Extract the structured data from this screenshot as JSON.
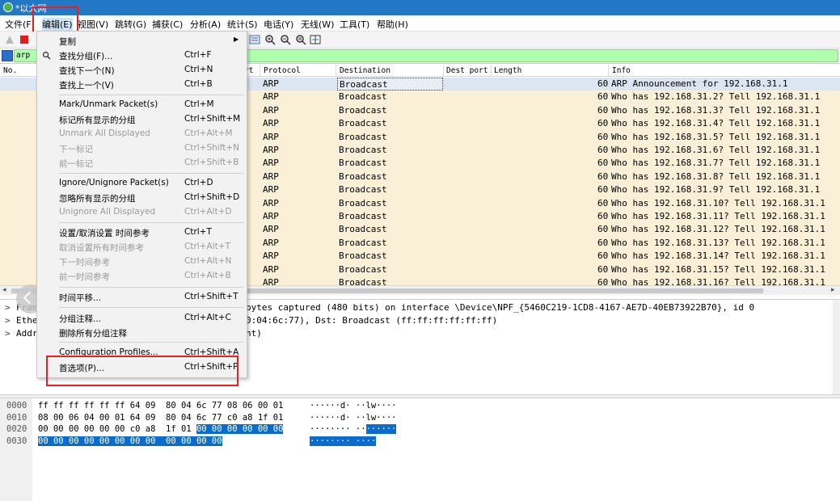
{
  "window": {
    "title": "*以太网"
  },
  "menubar": {
    "items": [
      {
        "label": "文件(F)"
      },
      {
        "label": "编辑(E)"
      },
      {
        "label": "视图(V)"
      },
      {
        "label": "跳转(G)"
      },
      {
        "label": "捕获(C)"
      },
      {
        "label": "分析(A)"
      },
      {
        "label": "统计(S)"
      },
      {
        "label": "电话(Y)"
      },
      {
        "label": "无线(W)"
      },
      {
        "label": "工具(T)"
      },
      {
        "label": "帮助(H)"
      }
    ]
  },
  "filter": {
    "value": "arp"
  },
  "packet_list": {
    "columns": [
      "No.",
      "rt",
      "Protocol",
      "Destination",
      "Dest port",
      "Length",
      "Info"
    ],
    "rows": [
      {
        "protocol": "ARP",
        "destination": "Broadcast",
        "length": "60",
        "info": "ARP Announcement for 192.168.31.1"
      },
      {
        "protocol": "ARP",
        "destination": "Broadcast",
        "length": "60",
        "info": "Who has 192.168.31.2? Tell 192.168.31.1"
      },
      {
        "protocol": "ARP",
        "destination": "Broadcast",
        "length": "60",
        "info": "Who has 192.168.31.3? Tell 192.168.31.1"
      },
      {
        "protocol": "ARP",
        "destination": "Broadcast",
        "length": "60",
        "info": "Who has 192.168.31.4? Tell 192.168.31.1"
      },
      {
        "protocol": "ARP",
        "destination": "Broadcast",
        "length": "60",
        "info": "Who has 192.168.31.5? Tell 192.168.31.1"
      },
      {
        "protocol": "ARP",
        "destination": "Broadcast",
        "length": "60",
        "info": "Who has 192.168.31.6? Tell 192.168.31.1"
      },
      {
        "protocol": "ARP",
        "destination": "Broadcast",
        "length": "60",
        "info": "Who has 192.168.31.7? Tell 192.168.31.1"
      },
      {
        "protocol": "ARP",
        "destination": "Broadcast",
        "length": "60",
        "info": "Who has 192.168.31.8? Tell 192.168.31.1"
      },
      {
        "protocol": "ARP",
        "destination": "Broadcast",
        "length": "60",
        "info": "Who has 192.168.31.9? Tell 192.168.31.1"
      },
      {
        "protocol": "ARP",
        "destination": "Broadcast",
        "length": "60",
        "info": "Who has 192.168.31.10? Tell 192.168.31.1"
      },
      {
        "protocol": "ARP",
        "destination": "Broadcast",
        "length": "60",
        "info": "Who has 192.168.31.11? Tell 192.168.31.1"
      },
      {
        "protocol": "ARP",
        "destination": "Broadcast",
        "length": "60",
        "info": "Who has 192.168.31.12? Tell 192.168.31.1"
      },
      {
        "protocol": "ARP",
        "destination": "Broadcast",
        "length": "60",
        "info": "Who has 192.168.31.13? Tell 192.168.31.1"
      },
      {
        "protocol": "ARP",
        "destination": "Broadcast",
        "length": "60",
        "info": "Who has 192.168.31.14? Tell 192.168.31.1"
      },
      {
        "protocol": "ARP",
        "destination": "Broadcast",
        "length": "60",
        "info": "Who has 192.168.31.15? Tell 192.168.31.1"
      },
      {
        "protocol": "ARP",
        "destination": "Broadcast",
        "length": "60",
        "info": "Who has 192.168.31.16? Tell 192.168.31.1"
      }
    ]
  },
  "details": {
    "rows": [
      {
        "arrow": ">",
        "text": "Fram",
        "rest": "bytes captured (480 bits) on interface \\Device\\NPF_{5460C219-1CD8-4167-AE7D-40EB73922B70}, id 0"
      },
      {
        "arrow": ">",
        "text": "Ethe",
        "rest": "0:04:6c:77), Dst: Broadcast (ff:ff:ff:ff:ff:ff)"
      },
      {
        "arrow": ">",
        "text": "Addr",
        "rest": "nt)"
      }
    ]
  },
  "bytes": {
    "rows": [
      {
        "offset": "0000",
        "hex": "ff ff ff ff ff ff 64 09  80 04 6c 77 08 06 00 01",
        "hex_sel": "",
        "ascii": "······d· ··lw····",
        "ascii_sel": ""
      },
      {
        "offset": "0010",
        "hex": "08 00 06 04 00 01 64 09  80 04 6c 77 c0 a8 1f 01",
        "hex_sel": "",
        "ascii": "······d· ··lw····",
        "ascii_sel": ""
      },
      {
        "offset": "0020",
        "hex": "00 00 00 00 00 00 c0 a8  1f 01 ",
        "hex_sel": "00 00 00 00 00 00",
        "ascii": "········ ··",
        "ascii_sel": "······"
      },
      {
        "offset": "0030",
        "hex": "",
        "hex_sel": "00 00 00 00 00 00 00 00  00 00 00 00",
        "ascii": "",
        "ascii_sel": "········ ····"
      }
    ]
  },
  "edit_menu": {
    "items": [
      {
        "label": "复制",
        "shortcut": "",
        "submenu": "▶",
        "disabled": false
      },
      {
        "label": "查找分组(F)...",
        "shortcut": "Ctrl+F",
        "icon": "search-icon",
        "disabled": false
      },
      {
        "label": "查找下一个(N)",
        "shortcut": "Ctrl+N",
        "disabled": false
      },
      {
        "label": "查找上一个(V)",
        "shortcut": "Ctrl+B",
        "disabled": false
      },
      {
        "label": "Mark/Unmark Packet(s)",
        "shortcut": "Ctrl+M",
        "disabled": false
      },
      {
        "label": "标记所有显示的分组",
        "shortcut": "Ctrl+Shift+M",
        "disabled": false
      },
      {
        "label": "Unmark All Displayed",
        "shortcut": "Ctrl+Alt+M",
        "disabled": true
      },
      {
        "label": "下一标记",
        "shortcut": "Ctrl+Shift+N",
        "disabled": true
      },
      {
        "label": "前一标记",
        "shortcut": "Ctrl+Shift+B",
        "disabled": true
      },
      {
        "label": "Ignore/Unignore Packet(s)",
        "shortcut": "Ctrl+D",
        "disabled": false
      },
      {
        "label": "忽略所有显示的分组",
        "shortcut": "Ctrl+Shift+D",
        "disabled": false
      },
      {
        "label": "Unignore All Displayed",
        "shortcut": "Ctrl+Alt+D",
        "disabled": true
      },
      {
        "label": "设置/取消设置 时间参考",
        "shortcut": "Ctrl+T",
        "disabled": false
      },
      {
        "label": "取消设置所有时间参考",
        "shortcut": "Ctrl+Alt+T",
        "disabled": true
      },
      {
        "label": "下一时间参考",
        "shortcut": "Ctrl+Alt+N",
        "disabled": true
      },
      {
        "label": "前一时间参考",
        "shortcut": "Ctrl+Alt+B",
        "disabled": true
      },
      {
        "label": "时间平移...",
        "shortcut": "Ctrl+Shift+T",
        "disabled": false
      },
      {
        "label": "分组注释...",
        "shortcut": "Ctrl+Alt+C",
        "disabled": false
      },
      {
        "label": "删除所有分组注释",
        "shortcut": "",
        "disabled": false
      },
      {
        "label": "Configuration Profiles...",
        "shortcut": "Ctrl+Shift+A",
        "disabled": false
      },
      {
        "label": "首选项(P)...",
        "shortcut": "Ctrl+Shift+P",
        "disabled": false
      }
    ]
  },
  "colors": {
    "highlight_box": "#e81f1f",
    "filter_valid": "#afffaf",
    "arp_row": "#faf0d7",
    "selected_bytes": "#0b6ccf"
  }
}
